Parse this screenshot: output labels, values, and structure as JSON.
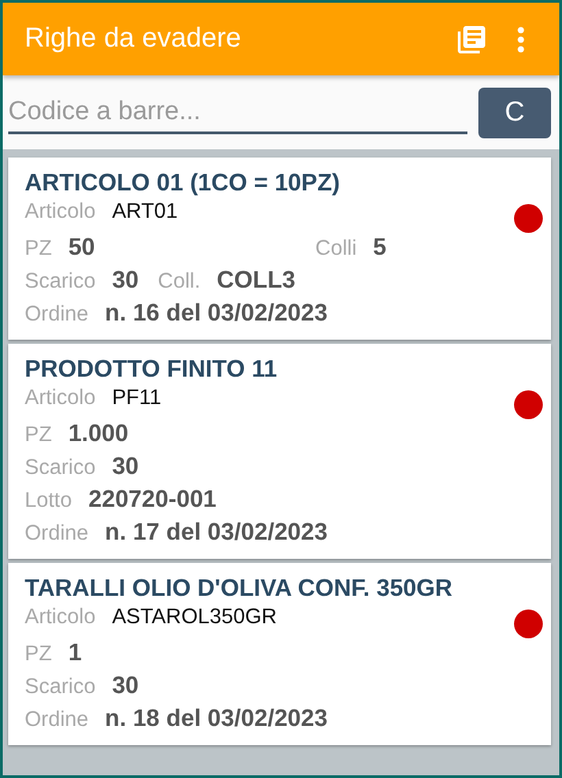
{
  "app_bar": {
    "title": "Righe da evadere"
  },
  "search": {
    "placeholder": "Codice a barre...",
    "button": "C"
  },
  "cards": [
    {
      "title": "ARTICOLO 01 (1CO = 10PZ)",
      "color": "#d00000",
      "rows": [
        {
          "kind": "inline",
          "fields": [
            {
              "label": "Articolo",
              "value": "ART01",
              "kind": "code"
            }
          ]
        },
        {
          "kind": "columns",
          "fields": [
            {
              "label": "PZ",
              "value": "50",
              "kind": "quantity"
            },
            {
              "label": "Colli",
              "value": "5",
              "kind": "quantity"
            }
          ]
        },
        {
          "kind": "inline",
          "fields": [
            {
              "label": "Scarico",
              "value": "30",
              "kind": "quantity"
            },
            {
              "label": "Coll.",
              "value": "COLL3",
              "kind": "quantity"
            }
          ]
        },
        {
          "kind": "inline",
          "fields": [
            {
              "label": "Ordine",
              "value": "n. 16 del 03/02/2023",
              "kind": "quantity"
            }
          ]
        }
      ]
    },
    {
      "title": "PRODOTTO FINITO 11",
      "color": "#d00000",
      "rows": [
        {
          "kind": "inline",
          "fields": [
            {
              "label": "Articolo",
              "value": "PF11",
              "kind": "code"
            }
          ]
        },
        {
          "kind": "inline",
          "fields": [
            {
              "label": "PZ",
              "value": "1.000",
              "kind": "quantity"
            }
          ]
        },
        {
          "kind": "inline",
          "fields": [
            {
              "label": "Scarico",
              "value": "30",
              "kind": "quantity"
            }
          ]
        },
        {
          "kind": "inline",
          "fields": [
            {
              "label": "Lotto",
              "value": "220720-001",
              "kind": "quantity"
            }
          ]
        },
        {
          "kind": "inline",
          "fields": [
            {
              "label": "Ordine",
              "value": "n. 17 del 03/02/2023",
              "kind": "quantity"
            }
          ]
        }
      ]
    },
    {
      "title": "TARALLI OLIO D'OLIVA CONF. 350GR",
      "color": "#d00000",
      "rows": [
        {
          "kind": "inline",
          "fields": [
            {
              "label": "Articolo",
              "value": "ASTAROL350GR",
              "kind": "code"
            }
          ]
        },
        {
          "kind": "inline",
          "fields": [
            {
              "label": "PZ",
              "value": "1",
              "kind": "quantity"
            }
          ]
        },
        {
          "kind": "inline",
          "fields": [
            {
              "label": "Scarico",
              "value": "30",
              "kind": "quantity"
            }
          ]
        },
        {
          "kind": "inline",
          "fields": [
            {
              "label": "Ordine",
              "value": "n. 18 del 03/02/2023",
              "kind": "quantity"
            }
          ]
        }
      ]
    }
  ]
}
